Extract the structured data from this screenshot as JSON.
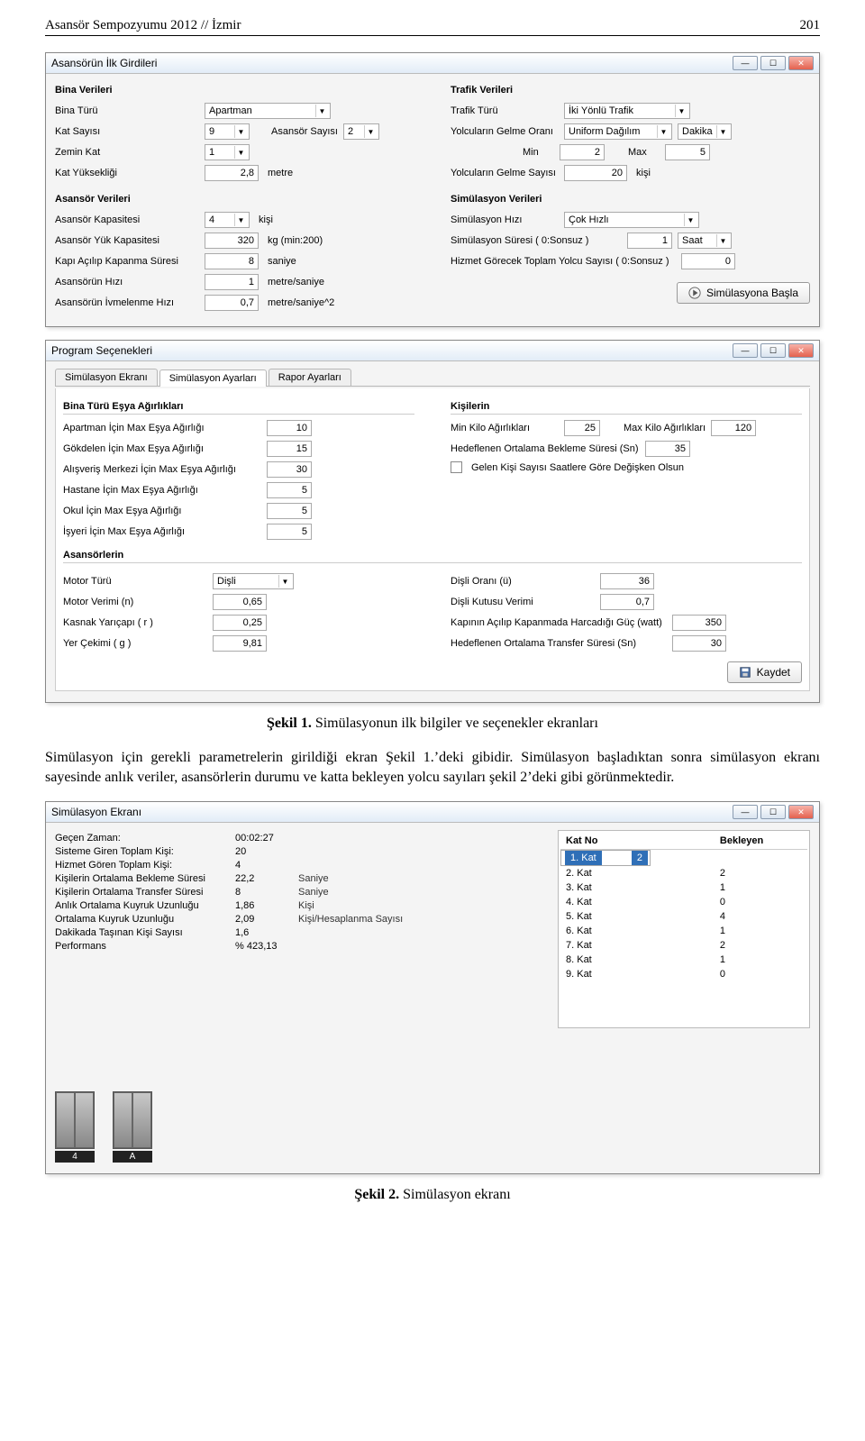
{
  "page": {
    "header_left": "Asansör Sempozyumu 2012 // İzmir",
    "header_right": "201"
  },
  "win1": {
    "title": "Asansörün İlk Girdileri",
    "bina": {
      "section": "Bina Verileri",
      "bina_turu_label": "Bina Türü",
      "bina_turu": "Apartman",
      "kat_sayisi_label": "Kat Sayısı",
      "kat_sayisi": "9",
      "asansor_sayisi_label": "Asansör Sayısı",
      "asansor_sayisi": "2",
      "zemin_kat_label": "Zemin Kat",
      "zemin_kat": "1",
      "kat_yuk_label": "Kat Yüksekliği",
      "kat_yuk": "2,8",
      "kat_yuk_unit": "metre"
    },
    "asansor": {
      "section": "Asansör Verileri",
      "kapasite_label": "Asansör Kapasitesi",
      "kapasite": "4",
      "kapasite_unit": "kişi",
      "yuk_label": "Asansör Yük Kapasitesi",
      "yuk": "320",
      "yuk_unit": "kg (min:200)",
      "kapi_label": "Kapı Açılıp Kapanma Süresi",
      "kapi": "8",
      "kapi_unit": "saniye",
      "hiz_label": "Asansörün Hızı",
      "hiz": "1",
      "hiz_unit": "metre/saniye",
      "ivme_label": "Asansörün İvmelenme Hızı",
      "ivme": "0,7",
      "ivme_unit": "metre/saniye^2"
    },
    "trafik": {
      "section": "Trafik Verileri",
      "turu_label": "Trafik Türü",
      "turu": "İki Yönlü Trafik",
      "gelme_label": "Yolcuların Gelme Oranı",
      "gelme": "Uniform Dağılım",
      "gelme_unit": "Dakika",
      "min_label": "Min",
      "min": "2",
      "max_label": "Max",
      "max": "5",
      "sayi_label": "Yolcuların Gelme Sayısı",
      "sayi": "20",
      "sayi_unit": "kişi"
    },
    "sim": {
      "section": "Simülasyon Verileri",
      "hiz_label": "Simülasyon Hızı",
      "hiz": "Çok Hızlı",
      "sure_label": "Simülasyon Süresi   ( 0:Sonsuz )",
      "sure": "1",
      "sure_unit": "Saat",
      "yolcu_label": "Hizmet Görecek Toplam Yolcu Sayısı ( 0:Sonsuz )",
      "yolcu": "0",
      "start": "Simülasyona Başla"
    }
  },
  "win2": {
    "title": "Program Seçenekleri",
    "tabs": [
      "Simülasyon Ekranı",
      "Simülasyon Ayarları",
      "Rapor Ayarları"
    ],
    "bina_grp": "Bina Türü Eşya Ağırlıkları",
    "rows_l": [
      {
        "label": "Apartman İçin Max Eşya Ağırlığı",
        "val": "10"
      },
      {
        "label": "Gökdelen İçin Max Eşya Ağırlığı",
        "val": "15"
      },
      {
        "label": "Alışveriş Merkezi İçin Max Eşya Ağırlığı",
        "val": "30"
      },
      {
        "label": "Hastane İçin Max Eşya Ağırlığı",
        "val": "5"
      },
      {
        "label": "Okul İçin Max Eşya Ağırlığı",
        "val": "5"
      },
      {
        "label": "İşyeri İçin Max Eşya Ağırlığı",
        "val": "5"
      }
    ],
    "kisi_grp": "Kişilerin",
    "min_kilo_label": "Min Kilo Ağırlıkları",
    "min_kilo": "25",
    "max_kilo_label": "Max Kilo Ağırlıkları",
    "max_kilo": "120",
    "hedef_bekleme_label": "Hedeflenen Ortalama Bekleme Süresi (Sn)",
    "hedef_bekleme": "35",
    "cb_label": "Gelen Kişi Sayısı Saatlere Göre Değişken Olsun",
    "asn_grp": "Asansörlerin",
    "motor_turu_label": "Motor Türü",
    "motor_turu": "Dişli",
    "disli_orani_label": "Dişli Oranı (ü)",
    "disli_orani": "36",
    "motor_verimi_label": "Motor Verimi (n)",
    "motor_verimi": "0,65",
    "kutu_label": "Dişli Kutusu Verimi",
    "kutu": "0,7",
    "kasnak_label": "Kasnak Yarıçapı ( r )",
    "kasnak": "0,25",
    "kapi_guc_label": "Kapının Açılıp Kapanmada Harcadığı Güç (watt)",
    "kapi_guc": "350",
    "yer_label": "Yer Çekimi ( g )",
    "yer": "9,81",
    "transfer_label": "Hedeflenen Ortalama Transfer Süresi (Sn)",
    "transfer": "30",
    "save": "Kaydet"
  },
  "caption1": {
    "bold": "Şekil 1.",
    "text": " Simülasyonun ilk bilgiler ve seçenekler ekranları"
  },
  "paragraph": "Simülasyon için gerekli parametrelerin girildiği ekran Şekil 1.’deki gibidir. Simülasyon başladıktan sonra simülasyon ekranı sayesinde anlık veriler, asansörlerin durumu ve katta bekleyen yolcu sayıları şekil 2’deki gibi görünmektedir.",
  "win3": {
    "title": "Simülasyon Ekranı",
    "stats": [
      {
        "k": "Geçen Zaman:",
        "v": "00:02:27",
        "u": ""
      },
      {
        "k": "Sisteme Giren Toplam Kişi:",
        "v": "20",
        "u": ""
      },
      {
        "k": "Hizmet Gören Toplam Kişi:",
        "v": "4",
        "u": ""
      },
      {
        "k": "Kişilerin Ortalama Bekleme Süresi",
        "v": "22,2",
        "u": "Saniye"
      },
      {
        "k": "Kişilerin Ortalama Transfer Süresi",
        "v": "8",
        "u": "Saniye"
      },
      {
        "k": "Anlık Ortalama Kuyruk Uzunluğu",
        "v": "1,86",
        "u": "Kişi"
      },
      {
        "k": "Ortalama Kuyruk Uzunluğu",
        "v": "2,09",
        "u": "Kişi/Hesaplanma Sayısı"
      },
      {
        "k": "Dakikada Taşınan Kişi Sayısı",
        "v": "1,6",
        "u": ""
      },
      {
        "k": "Performans",
        "v": "% 423,13",
        "u": ""
      }
    ],
    "kat_head1": "Kat No",
    "kat_head2": "Bekleyen",
    "kats": [
      {
        "n": "1. Kat",
        "b": "2",
        "sel": true
      },
      {
        "n": "2. Kat",
        "b": "2"
      },
      {
        "n": "3. Kat",
        "b": "1"
      },
      {
        "n": "4. Kat",
        "b": "0"
      },
      {
        "n": "5. Kat",
        "b": "4"
      },
      {
        "n": "6. Kat",
        "b": "1"
      },
      {
        "n": "7. Kat",
        "b": "2"
      },
      {
        "n": "8. Kat",
        "b": "1"
      },
      {
        "n": "9. Kat",
        "b": "0"
      }
    ],
    "elev": [
      "4",
      "A"
    ]
  },
  "caption2": {
    "bold": "Şekil 2.",
    "text": " Simülasyon ekranı"
  }
}
